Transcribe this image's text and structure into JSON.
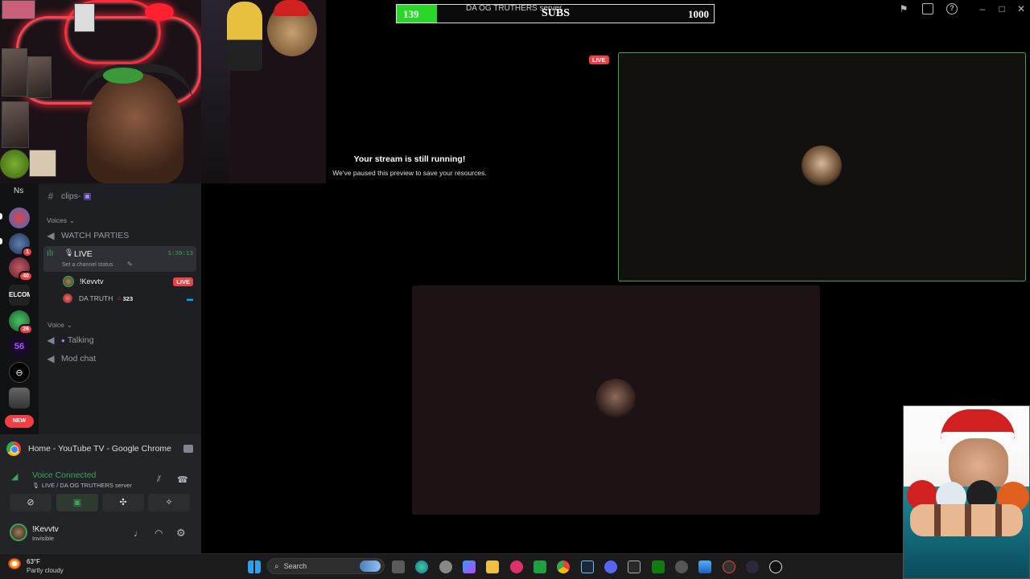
{
  "subs_goal": {
    "server_label": "DA OG TRUTHERS server",
    "current": "139",
    "title": "SUBS",
    "goal": "1000",
    "progress_fraction": 0.139
  },
  "window_controls": {
    "icons": [
      "flag-icon",
      "inbox-icon",
      "help-icon",
      "minimize-icon",
      "maximize-icon",
      "close-icon"
    ]
  },
  "server_rail": {
    "top_label": "Ns",
    "badges": [
      "1",
      "1",
      "40",
      "26"
    ],
    "server_text_logo": "ELCOM",
    "server_number": "56",
    "new_label": "NEW"
  },
  "channels": {
    "clips": "clips-",
    "category_voices": "Voices",
    "watch_parties": "WATCH PARTIES",
    "live_channel": {
      "name": "LIVE",
      "timer": "1:39:13",
      "status_placeholder": "Set a channel status"
    },
    "members": [
      {
        "name": "!Kevvtv",
        "badge": "LIVE"
      },
      {
        "name": "DA TRUTH",
        "count": "323"
      }
    ],
    "category_voice": "Voice",
    "talking": "Talking",
    "mod_chat": "Mod chat"
  },
  "panel": {
    "stream_title": "Home - YouTube TV - Google Chrome",
    "voice_connected": "Voice Connected",
    "voice_location": "LIVE / DA OG TRUTHERS server",
    "username": "!Kevvtv",
    "user_status": "Invisible"
  },
  "stream": {
    "message_title": "Your stream is still running!",
    "message_body": "We've paused this preview to save your resources.",
    "live_label": "LIVE"
  },
  "taskbar": {
    "weather_temp": "63°F",
    "weather_desc": "Partly cloudy",
    "search_placeholder": "Search"
  },
  "colors": {
    "accent_green": "#3ba55c",
    "live_red": "#f23f43",
    "subs_fill": "#2bd62b"
  }
}
